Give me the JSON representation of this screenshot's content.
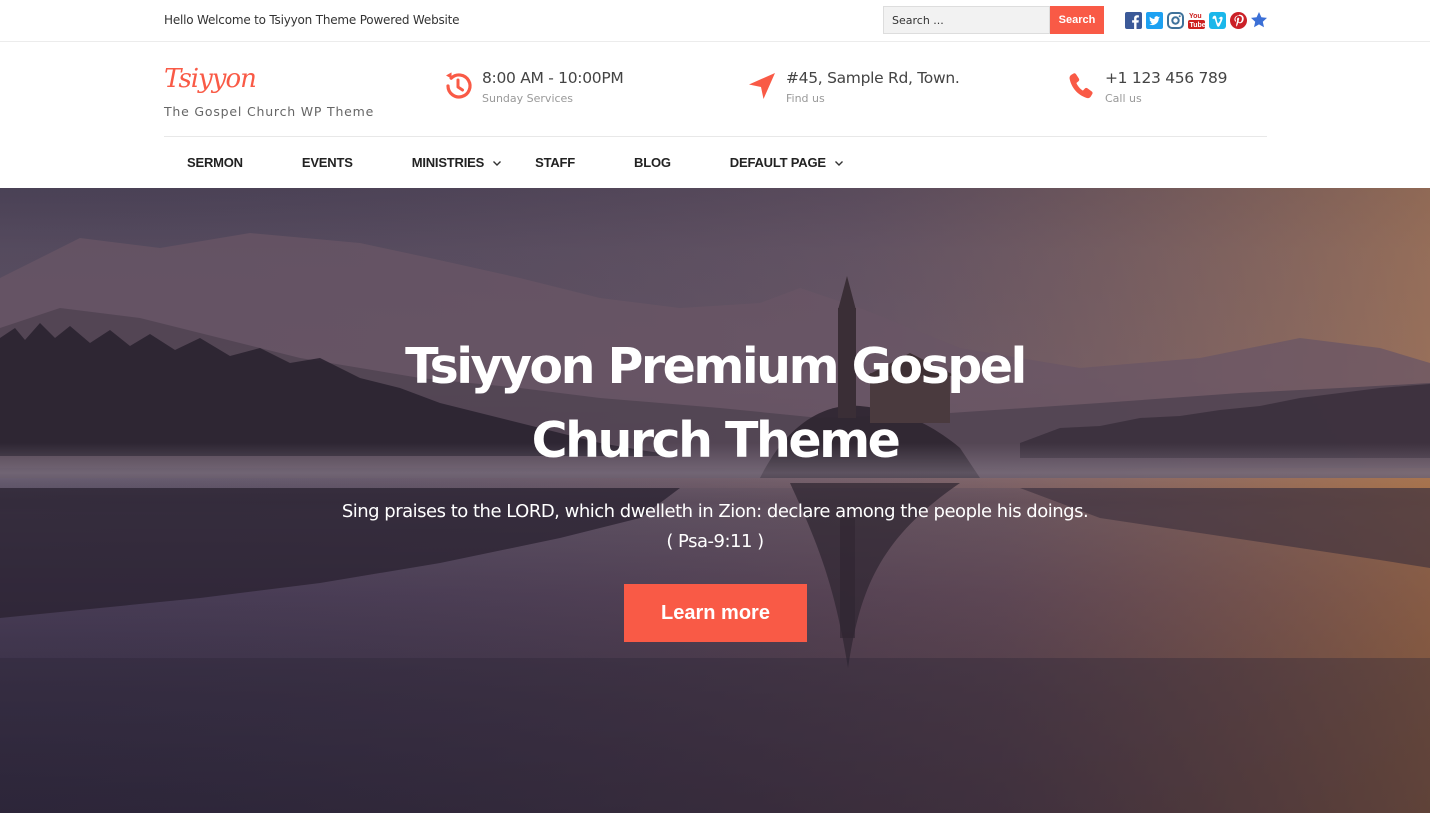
{
  "topbar": {
    "welcome": "Hello Welcome to Tsiyyon Theme Powered Website",
    "search_placeholder": "Search ...",
    "search_button": "Search",
    "socials": [
      {
        "icon": "facebook-icon",
        "color": "#3b5998"
      },
      {
        "icon": "twitter-icon",
        "color": "#1da1f2"
      },
      {
        "icon": "instagram-icon",
        "color": "#3f729b"
      },
      {
        "icon": "youtube-icon",
        "color": "#cd201f"
      },
      {
        "icon": "vimeo-icon",
        "color": "#1ab7ea"
      },
      {
        "icon": "pinterest-icon",
        "color": "#cb2027"
      },
      {
        "icon": "star-icon",
        "color": "#3b6fd6"
      }
    ]
  },
  "header": {
    "logo": "Tsiyyon",
    "tagline": "The Gospel Church WP Theme",
    "info": [
      {
        "icon": "clock-history-icon",
        "main": "8:00 AM - 10:00PM",
        "sub": "Sunday Services"
      },
      {
        "icon": "location-arrow-icon",
        "main": "#45, Sample Rd, Town.",
        "sub": "Find us"
      },
      {
        "icon": "phone-icon",
        "main": "+1 123 456 789",
        "sub": "Call us"
      }
    ]
  },
  "nav": [
    {
      "label": "SERMON",
      "dropdown": false
    },
    {
      "label": "EVENTS",
      "dropdown": false
    },
    {
      "label": "MINISTRIES",
      "dropdown": true
    },
    {
      "label": "STAFF",
      "dropdown": false
    },
    {
      "label": "BLOG",
      "dropdown": false
    },
    {
      "label": "DEFAULT PAGE",
      "dropdown": true
    }
  ],
  "hero": {
    "title_line1": "Tsiyyon Premium Gospel",
    "title_line2": "Church Theme",
    "subtitle": "Sing praises to the LORD, which dwelleth in Zion: declare among the people his doings. ( Psa-9:11 )",
    "button": "Learn more"
  },
  "colors": {
    "accent": "#f95a46"
  }
}
